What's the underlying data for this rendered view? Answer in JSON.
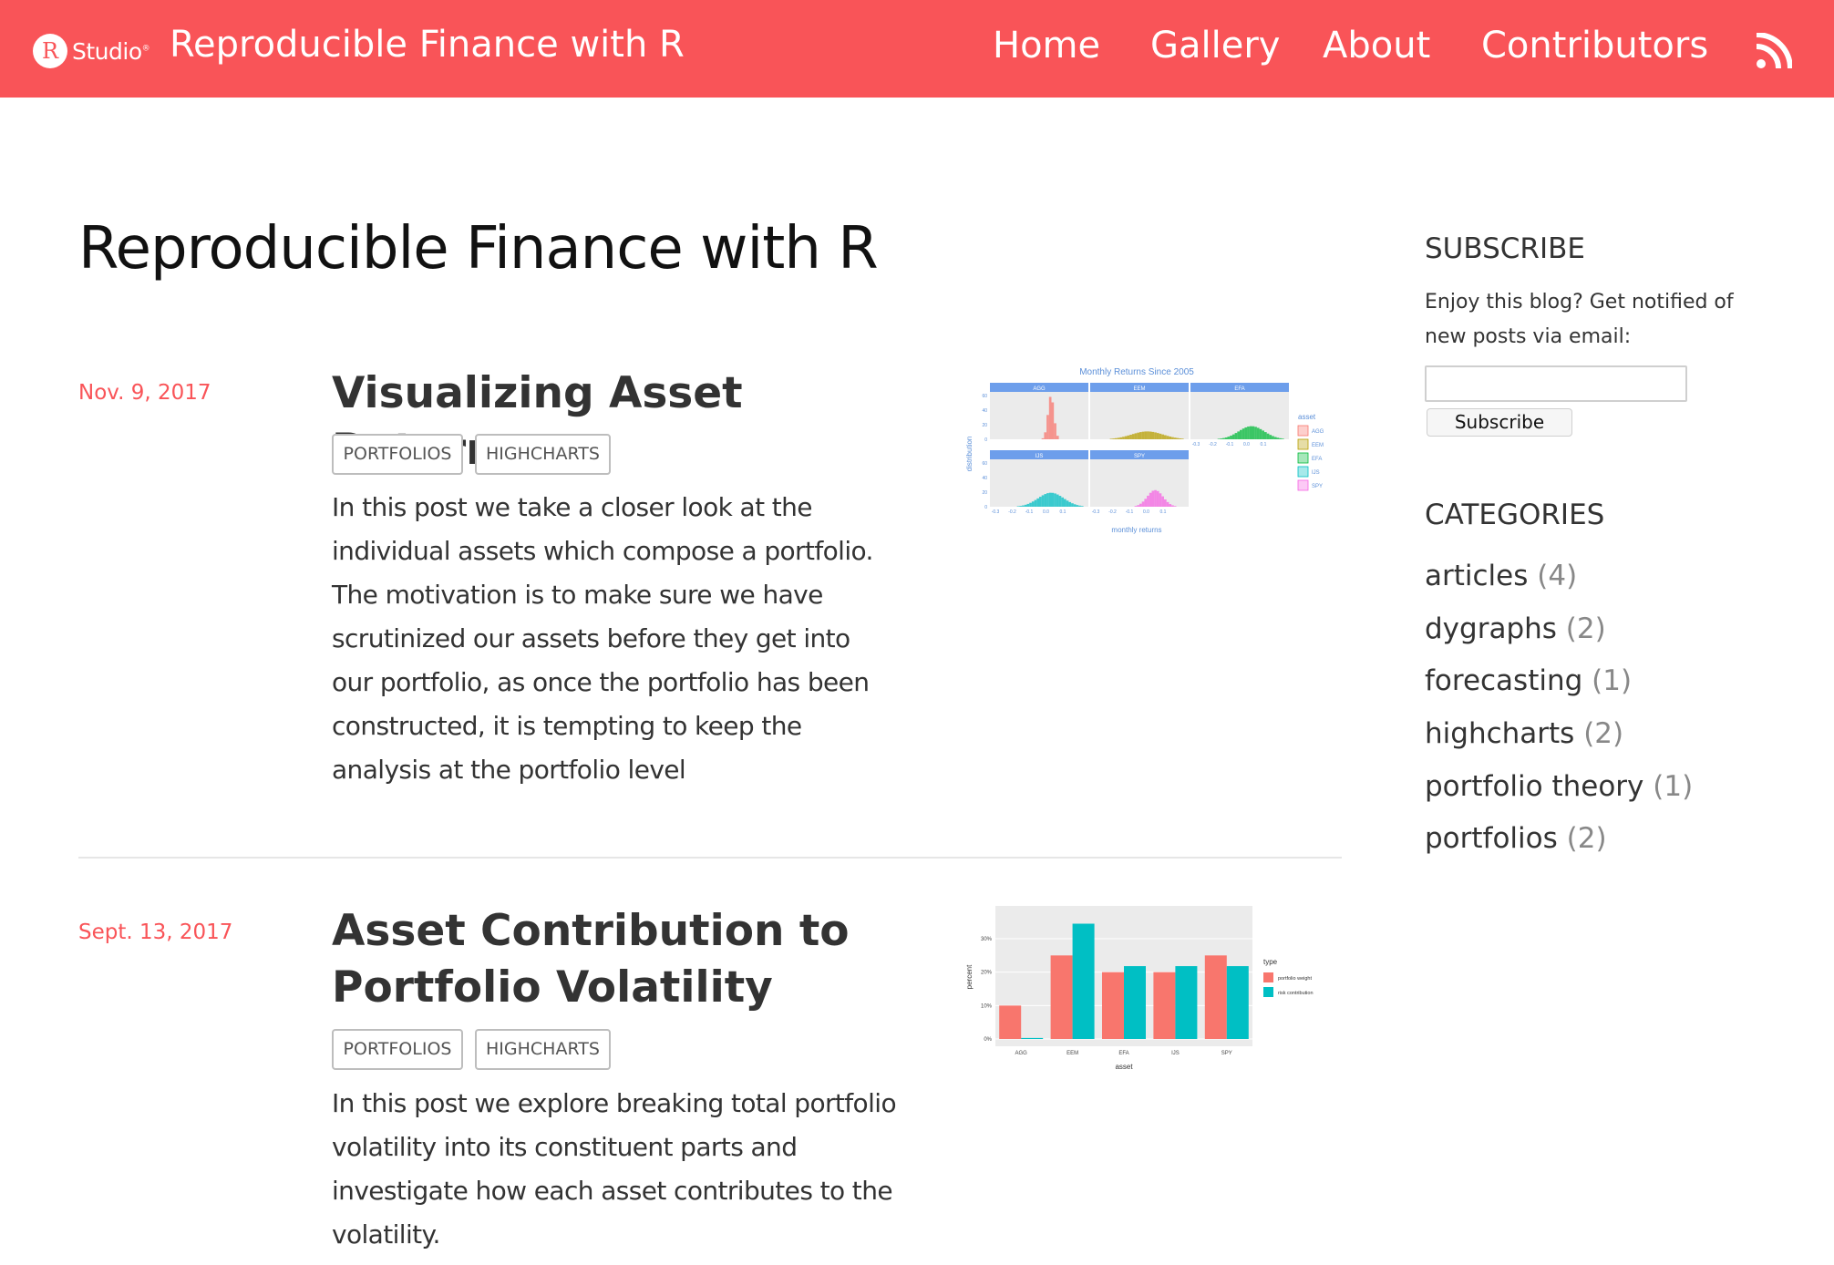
{
  "header": {
    "logo_letter": "R",
    "logo_text": "Studio",
    "logo_mark": "®",
    "site_title": "Reproducible Finance with R",
    "nav": [
      "Home",
      "Gallery",
      "About",
      "Contributors"
    ],
    "rss_icon": "rss-icon",
    "bg_color": "#f95458"
  },
  "main": {
    "page_title": "Reproducible Finance with R",
    "posts": [
      {
        "date": "Nov. 9, 2017",
        "title": "Visualizing Asset Returns",
        "tags": [
          "PORTFOLIOS",
          "HIGHCHARTS"
        ],
        "excerpt": "In this post we take a closer look at the individual assets which compose a portfolio. The motivation is to make sure we have scrutinized our assets before they get into our portfolio, as once the portfolio has been constructed, it is tempting to keep the analysis at the portfolio level",
        "thumbnail": {
          "title": "Monthly Returns Since 2005",
          "panels": [
            "AGG",
            "EEM",
            "EFA",
            "IJS",
            "SPY"
          ],
          "y_label": "distribution",
          "x_label": "monthly returns",
          "y_ticks": [
            "60",
            "40",
            "20",
            "0"
          ],
          "x_ticks": [
            "-0.3",
            "-0.2",
            "-0.1",
            "0.0",
            "0.1"
          ],
          "legend_title": "asset",
          "legend": [
            "AGG",
            "EEM",
            "EFA",
            "IJS",
            "SPY"
          ]
        }
      },
      {
        "date": "Sept. 13, 2017",
        "title_line1": "Asset Contribution to",
        "title_line2": "Portfolio Volatility",
        "tags": [
          "PORTFOLIOS",
          "HIGHCHARTS"
        ],
        "excerpt": "In this post we explore breaking total portfolio volatility into its constituent parts and investigate how each asset contributes to the volatility.",
        "thumbnail": {
          "y_label": "percent",
          "x_label": "asset",
          "y_ticks": [
            "30%",
            "20%",
            "10%",
            "0%"
          ],
          "legend_title": "type",
          "legend": [
            "portfolio weight",
            "risk contribution"
          ]
        }
      }
    ]
  },
  "sidebar": {
    "subscribe_heading": "SUBSCRIBE",
    "subscribe_text": "Enjoy this blog? Get notified of new posts via email:",
    "email_value": "",
    "subscribe_button": "Subscribe",
    "categories_heading": "CATEGORIES",
    "categories": [
      {
        "name": "articles",
        "count": "(4)"
      },
      {
        "name": "dygraphs",
        "count": "(2)"
      },
      {
        "name": "forecasting",
        "count": "(1)"
      },
      {
        "name": "highcharts",
        "count": "(2)"
      },
      {
        "name": "portfolio theory",
        "count": "(1)"
      },
      {
        "name": "portfolios",
        "count": "(2)"
      }
    ]
  },
  "chart_data": [
    {
      "type": "bar",
      "title": "Monthly Returns Since 2005",
      "xlabel": "monthly returns",
      "ylabel": "distribution",
      "ylim": [
        0,
        60
      ],
      "facets": [
        "AGG",
        "EEM",
        "EFA",
        "IJS",
        "SPY"
      ],
      "legend_title": "asset",
      "legend_placement": "right",
      "colors": {
        "AGG": "#f8766d",
        "EEM": "#b79f00",
        "EFA": "#00ba38",
        "IJS": "#00bfc4",
        "SPY": "#f564e3"
      }
    },
    {
      "type": "bar",
      "categories": [
        "AGG",
        "EEM",
        "EFA",
        "IJS",
        "SPY"
      ],
      "xlabel": "asset",
      "ylabel": "percent",
      "ylim": [
        0,
        0.36
      ],
      "legend_title": "type",
      "legend_placement": "right",
      "series": [
        {
          "name": "portfolio weight",
          "color": "#f8766d",
          "values": [
            0.1,
            0.25,
            0.2,
            0.2,
            0.25
          ]
        },
        {
          "name": "risk contribution",
          "color": "#00bfc4",
          "values": [
            0.003,
            0.345,
            0.218,
            0.218,
            0.218
          ]
        }
      ]
    }
  ]
}
